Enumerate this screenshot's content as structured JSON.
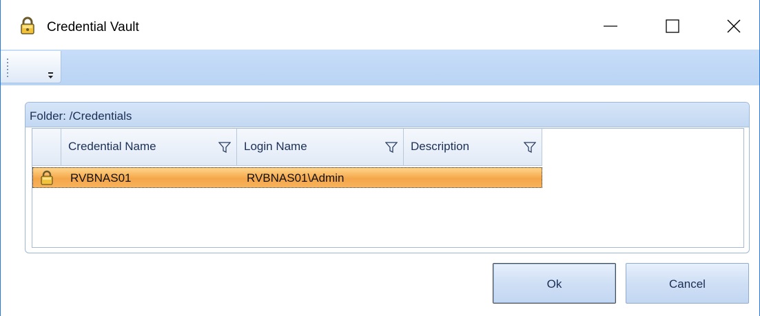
{
  "window": {
    "title": "Credential Vault",
    "icon": "padlock-icon",
    "controls": [
      "minimize-icon",
      "maximize-icon",
      "close-icon"
    ],
    "accent": "#2b79d6"
  },
  "toolbar": {
    "overflow_icon": "toolbar-overflow-icon"
  },
  "panel": {
    "caption": "Folder: /Credentials"
  },
  "grid": {
    "columns": [
      "Credential Name",
      "Login Name",
      "Description"
    ],
    "rows": [
      {
        "credential_name": "RVBNAS01",
        "login_name": "RVBNAS01\\Admin",
        "description": "",
        "icon": "padlock-icon",
        "selected": true
      }
    ],
    "selection_color": "#f5a64a"
  },
  "buttons": {
    "ok": "Ok",
    "cancel": "Cancel"
  }
}
